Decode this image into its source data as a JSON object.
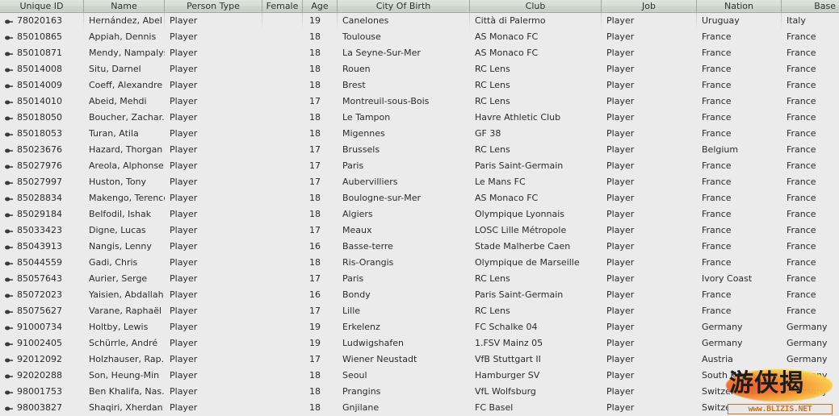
{
  "table": {
    "columns": [
      {
        "key": "unique_id",
        "label": "Unique ID",
        "width": 104,
        "align": "left"
      },
      {
        "key": "name",
        "label": "Name",
        "width": 100,
        "align": "left"
      },
      {
        "key": "person_type",
        "label": "Person Type",
        "width": 121,
        "align": "left"
      },
      {
        "key": "female",
        "label": "Female",
        "width": 50,
        "align": "left"
      },
      {
        "key": "age",
        "label": "Age",
        "width": 43,
        "align": "left"
      },
      {
        "key": "city_of_birth",
        "label": "City Of Birth",
        "width": 164,
        "align": "left"
      },
      {
        "key": "club",
        "label": "Club",
        "width": 163,
        "align": "left"
      },
      {
        "key": "job",
        "label": "Job",
        "width": 118,
        "align": "left"
      },
      {
        "key": "nation",
        "label": "Nation",
        "width": 105,
        "align": "left"
      },
      {
        "key": "based",
        "label": "Base",
        "width": 71,
        "align": "right"
      }
    ],
    "row_icon": "pin-icon",
    "rows": [
      {
        "unique_id": "78020163",
        "name": "Hernández, Abel",
        "person_type": "Player",
        "female": "",
        "age": "19",
        "city_of_birth": "Canelones",
        "club": "Città di Palermo",
        "job": "Player",
        "nation": "Uruguay",
        "based": "Italy"
      },
      {
        "unique_id": "85010865",
        "name": "Appiah, Dennis",
        "person_type": "Player",
        "female": "",
        "age": "18",
        "city_of_birth": "Toulouse",
        "club": "AS Monaco FC",
        "job": "Player",
        "nation": "France",
        "based": "France"
      },
      {
        "unique_id": "85010871",
        "name": "Mendy, Nampalys",
        "person_type": "Player",
        "female": "",
        "age": "18",
        "city_of_birth": "La Seyne-Sur-Mer",
        "club": "AS Monaco FC",
        "job": "Player",
        "nation": "France",
        "based": "France"
      },
      {
        "unique_id": "85014008",
        "name": "Situ, Darnel",
        "person_type": "Player",
        "female": "",
        "age": "18",
        "city_of_birth": "Rouen",
        "club": "RC Lens",
        "job": "Player",
        "nation": "France",
        "based": "France"
      },
      {
        "unique_id": "85014009",
        "name": "Coeff, Alexandre",
        "person_type": "Player",
        "female": "",
        "age": "18",
        "city_of_birth": "Brest",
        "club": "RC Lens",
        "job": "Player",
        "nation": "France",
        "based": "France"
      },
      {
        "unique_id": "85014010",
        "name": "Abeid, Mehdi",
        "person_type": "Player",
        "female": "",
        "age": "17",
        "city_of_birth": "Montreuil-sous-Bois",
        "club": "RC Lens",
        "job": "Player",
        "nation": "France",
        "based": "France"
      },
      {
        "unique_id": "85018050",
        "name": "Boucher, Zachar..",
        "person_type": "Player",
        "female": "",
        "age": "18",
        "city_of_birth": "Le Tampon",
        "club": "Havre Athletic Club",
        "job": "Player",
        "nation": "France",
        "based": "France"
      },
      {
        "unique_id": "85018053",
        "name": "Turan, Atila",
        "person_type": "Player",
        "female": "",
        "age": "18",
        "city_of_birth": "Migennes",
        "club": "GF 38",
        "job": "Player",
        "nation": "France",
        "based": "France"
      },
      {
        "unique_id": "85023676",
        "name": "Hazard, Thorgan",
        "person_type": "Player",
        "female": "",
        "age": "17",
        "city_of_birth": "Brussels",
        "club": "RC Lens",
        "job": "Player",
        "nation": "Belgium",
        "based": "France"
      },
      {
        "unique_id": "85027976",
        "name": "Areola, Alphonse",
        "person_type": "Player",
        "female": "",
        "age": "17",
        "city_of_birth": "Paris",
        "club": "Paris Saint-Germain",
        "job": "Player",
        "nation": "France",
        "based": "France"
      },
      {
        "unique_id": "85027997",
        "name": "Huston, Tony",
        "person_type": "Player",
        "female": "",
        "age": "17",
        "city_of_birth": "Aubervilliers",
        "club": "Le Mans FC",
        "job": "Player",
        "nation": "France",
        "based": "France"
      },
      {
        "unique_id": "85028834",
        "name": "Makengo, Terence",
        "person_type": "Player",
        "female": "",
        "age": "18",
        "city_of_birth": "Boulogne-sur-Mer",
        "club": "AS Monaco FC",
        "job": "Player",
        "nation": "France",
        "based": "France"
      },
      {
        "unique_id": "85029184",
        "name": "Belfodil, Ishak",
        "person_type": "Player",
        "female": "",
        "age": "18",
        "city_of_birth": "Algiers",
        "club": "Olympique Lyonnais",
        "job": "Player",
        "nation": "France",
        "based": "France"
      },
      {
        "unique_id": "85033423",
        "name": "Digne, Lucas",
        "person_type": "Player",
        "female": "",
        "age": "17",
        "city_of_birth": "Meaux",
        "club": "LOSC Lille Métropole",
        "job": "Player",
        "nation": "France",
        "based": "France"
      },
      {
        "unique_id": "85043913",
        "name": "Nangis, Lenny",
        "person_type": "Player",
        "female": "",
        "age": "16",
        "city_of_birth": "Basse-terre",
        "club": "Stade Malherbe Caen",
        "job": "Player",
        "nation": "France",
        "based": "France"
      },
      {
        "unique_id": "85044559",
        "name": "Gadi, Chris",
        "person_type": "Player",
        "female": "",
        "age": "18",
        "city_of_birth": "Ris-Orangis",
        "club": "Olympique de Marseille",
        "job": "Player",
        "nation": "France",
        "based": "France"
      },
      {
        "unique_id": "85057643",
        "name": "Aurier, Serge",
        "person_type": "Player",
        "female": "",
        "age": "17",
        "city_of_birth": "Paris",
        "club": "RC Lens",
        "job": "Player",
        "nation": "Ivory Coast",
        "based": "France"
      },
      {
        "unique_id": "85072023",
        "name": "Yaisien, Abdallah",
        "person_type": "Player",
        "female": "",
        "age": "16",
        "city_of_birth": "Bondy",
        "club": "Paris Saint-Germain",
        "job": "Player",
        "nation": "France",
        "based": "France"
      },
      {
        "unique_id": "85075627",
        "name": "Varane, Raphaël",
        "person_type": "Player",
        "female": "",
        "age": "17",
        "city_of_birth": "Lille",
        "club": "RC Lens",
        "job": "Player",
        "nation": "France",
        "based": "France"
      },
      {
        "unique_id": "91000734",
        "name": "Holtby, Lewis",
        "person_type": "Player",
        "female": "",
        "age": "19",
        "city_of_birth": "Erkelenz",
        "club": "FC Schalke 04",
        "job": "Player",
        "nation": "Germany",
        "based": "Germany"
      },
      {
        "unique_id": "91002405",
        "name": "Schürrle, André",
        "person_type": "Player",
        "female": "",
        "age": "19",
        "city_of_birth": "Ludwigshafen",
        "club": "1.FSV Mainz 05",
        "job": "Player",
        "nation": "Germany",
        "based": "Germany"
      },
      {
        "unique_id": "92012092",
        "name": "Holzhauser, Rap..",
        "person_type": "Player",
        "female": "",
        "age": "17",
        "city_of_birth": "Wiener Neustadt",
        "club": "VfB Stuttgart II",
        "job": "Player",
        "nation": "Austria",
        "based": "Germany"
      },
      {
        "unique_id": "92020288",
        "name": "Son, Heung-Min",
        "person_type": "Player",
        "female": "",
        "age": "18",
        "city_of_birth": "Seoul",
        "club": "Hamburger SV",
        "job": "Player",
        "nation": "South Korea",
        "based": "Germany"
      },
      {
        "unique_id": "98001753",
        "name": "Ben Khalifa, Nas..",
        "person_type": "Player",
        "female": "",
        "age": "18",
        "city_of_birth": "Prangins",
        "club": "VfL Wolfsburg",
        "job": "Player",
        "nation": "Switzerland",
        "based": "Germany"
      },
      {
        "unique_id": "98003827",
        "name": "Shaqiri, Xherdan",
        "person_type": "Player",
        "female": "",
        "age": "18",
        "city_of_birth": "Gnjilane",
        "club": "FC Basel",
        "job": "Player",
        "nation": "Switzerland",
        "based": "Germany"
      }
    ]
  },
  "watermark": {
    "chinese_text": "游侠揭",
    "url_text": "www.BLIZIS.NET"
  },
  "colors": {
    "header_bg": "#ced6ce",
    "row_bg": "#ebebeb",
    "text": "#2b2b2b",
    "grid_line": "#9fa89f",
    "watermark_orange": "#f2712c"
  }
}
